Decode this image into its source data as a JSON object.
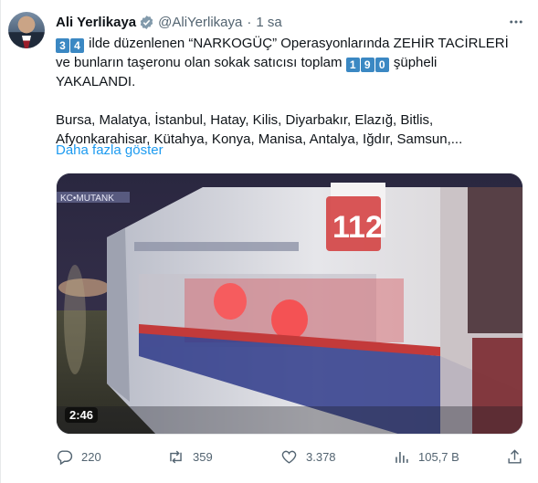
{
  "author": {
    "name": "Ali Yerlikaya",
    "handle": "@AliYerlikaya",
    "separator": "·",
    "time": "1 sa"
  },
  "icons": {
    "verified": "verified-badge-icon",
    "more": "more-horizontal-icon",
    "reply": "reply-icon",
    "retweet": "retweet-icon",
    "like": "like-icon",
    "views": "views-icon",
    "share": "share-icon"
  },
  "tweet": {
    "line1_digits": [
      "3",
      "4"
    ],
    "line1_text": " ilde düzenlenen “NARKOGÜÇ” Operasyonlarında ZEHİR TACİRLERİ",
    "line2_pre": "ve bunların taşeronu olan sokak satıcısı toplam ",
    "line2_digits": [
      "1",
      "9",
      "0"
    ],
    "line2_post": " şüpheli",
    "line3": "YAKALANDI.",
    "line4": "Bursa, Malatya, İstanbul, Hatay, Kilis, Diyarbakır, Elazığ, Bitlis,",
    "line5": "Afyonkarahisar, Kütahya, Konya, Manisa, Antalya, Iğdır, Samsun,...",
    "show_more": "Daha fazla göster"
  },
  "media": {
    "duration": "2:46",
    "vehicle_text": "112"
  },
  "actions": {
    "replies": "220",
    "retweets": "359",
    "likes": "3.378",
    "views": "105,7 B"
  },
  "colors": {
    "accent": "#1d9bf0",
    "keycap": "#3b88c3",
    "muted": "#536471"
  }
}
